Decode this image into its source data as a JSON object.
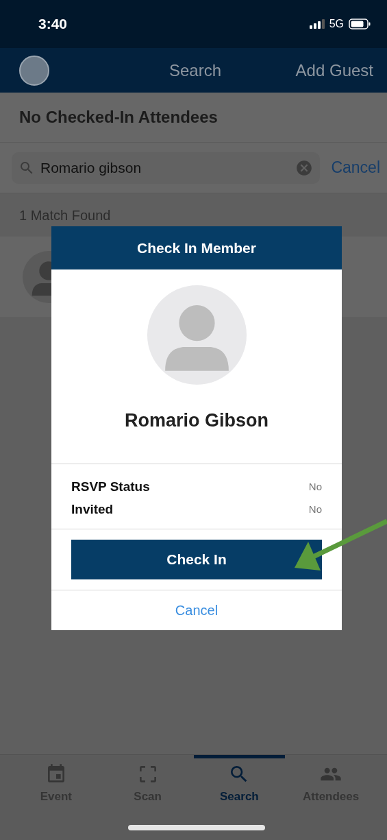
{
  "status_bar": {
    "time": "3:40",
    "network": "5G"
  },
  "nav_bar": {
    "title": "Search",
    "action": "Add Guest"
  },
  "header": "No Checked-In Attendees",
  "search": {
    "value": "Romario gibson",
    "cancel": "Cancel"
  },
  "match_count": "1 Match Found",
  "dialog": {
    "title": "Check In Member",
    "name": "Romario Gibson",
    "details": [
      {
        "label": "RSVP Status",
        "value": "No"
      },
      {
        "label": "Invited",
        "value": "No"
      }
    ],
    "primary": "Check In",
    "cancel": "Cancel"
  },
  "tabs": [
    {
      "label": "Event",
      "kind": "event",
      "selected": false
    },
    {
      "label": "Scan",
      "kind": "scan",
      "selected": false
    },
    {
      "label": "Search",
      "kind": "search",
      "selected": true
    },
    {
      "label": "Attendees",
      "kind": "attendees",
      "selected": false
    }
  ]
}
